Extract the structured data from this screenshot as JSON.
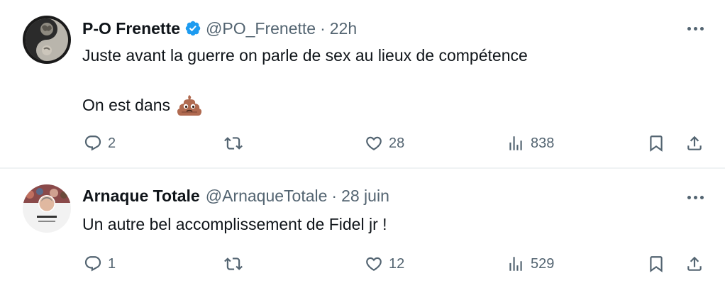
{
  "tweets": [
    {
      "name": "P-O Frenette",
      "verified": true,
      "handle": "@PO_Frenette",
      "separator": "·",
      "time": "22h",
      "line1": "Juste avant la guerre on parle de sex au lieux de compétence",
      "line2": "On est dans",
      "emoji": "poop-emoji",
      "replies": "2",
      "retweets": "",
      "likes": "28",
      "views": "838"
    },
    {
      "name": "Arnaque Totale",
      "verified": false,
      "handle": "@ArnaqueTotale",
      "separator": "·",
      "time": "28 juin",
      "line1": "Un autre bel accomplissement de Fidel jr !",
      "replies": "1",
      "retweets": "",
      "likes": "12",
      "views": "529"
    }
  ],
  "colors": {
    "text": "#0f1419",
    "secondary": "#536471",
    "verified": "#1d9bf0",
    "divider": "#eff3f4"
  },
  "icons": [
    "reply-icon",
    "retweet-icon",
    "like-icon",
    "views-icon",
    "bookmark-icon",
    "share-icon",
    "more-icon",
    "verified-badge-icon"
  ]
}
